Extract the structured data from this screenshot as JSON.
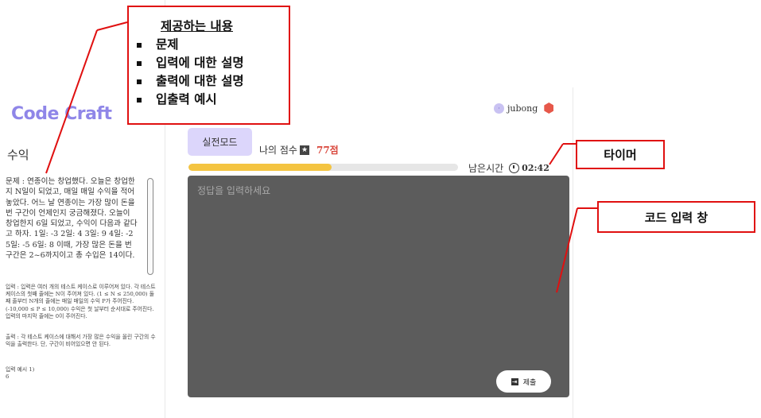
{
  "app": {
    "logo": "Code Craft"
  },
  "user": {
    "avatar_initial": "·",
    "name": "jubong"
  },
  "problem": {
    "title": "수익",
    "statement": "문제 : 연종이는 창업했다. 오늘은 창업한지 N일이 되었고, 매일 매일 수익을 적어놓았다. 어느 날 연종이는 가장 많이 돈을 번 구간이 언제인지 궁금해졌다. 오늘이 창업한지 6일 되었고, 수익이 다음과 같다고 하자. 1일: -3 2일: 4 3일: 9 4일: -2 5일: -5 6일: 8 이때, 가장 많은 돈을 번 구간은 2~6까지이고 총 수입은 14이다.",
    "input": "입력 : 입력은 여러 개의 테스트 케이스로 이루어져 있다. 각 테스트 케이스의 첫째 줄에는 N이 주어져 있다. (1 ≤ N ≤ 250,000) 둘째 줄부터 N개의 줄에는 매일 매일의 수익 P가 주어진다. (-10,000 ≤ P ≤ 10,000) 수익은 첫 날부터 순서대로 주어진다. 입력의 마지막 줄에는 0이 주어진다.",
    "output": "출력 : 각 테스트 케이스에 대해서 가장 많은 수익을 올린 구간의 수익을 출력한다. 단, 구간이 비어있으면 안 된다.",
    "example_label": "입력 예시 1)",
    "example_value": "6"
  },
  "mode": {
    "label": "실전모드"
  },
  "score": {
    "label": "나의 점수",
    "star": "★",
    "value": "77점"
  },
  "timer": {
    "label": "남은시간",
    "value": "02:42",
    "progress": 0.53
  },
  "editor": {
    "placeholder": "정답을 입력하세요"
  },
  "submit": {
    "icon": "⇥",
    "label": "제출"
  },
  "annotations": {
    "info_title": "제공하는 내용",
    "info_items": [
      "문제",
      "입력에 대한 설명",
      "출력에 대한 설명",
      "입출력 예시"
    ],
    "timer_label": "타이머",
    "editor_label": "코드 입력 창"
  },
  "colors": {
    "accent": "#8f86e8",
    "mode_bg": "#dcd6fb",
    "progress": "#f4c441",
    "score": "#d9453a",
    "editor_bg": "#5c5c5c",
    "annotation": "#e01010"
  }
}
